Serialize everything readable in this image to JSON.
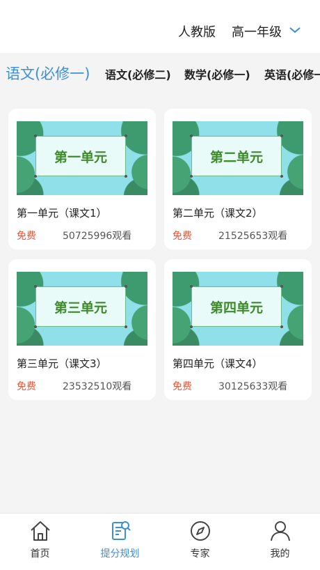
{
  "header": {
    "edition": "人教版",
    "grade": "高一年级",
    "grade_dropdown_icon": "chevron-down-icon"
  },
  "tabs": [
    {
      "label": "语文(必修一)",
      "active": true
    },
    {
      "label": "语文(必修二)",
      "active": false
    },
    {
      "label": "数学(必修一)",
      "active": false
    },
    {
      "label": "英语(必修一",
      "active": false
    }
  ],
  "cards": [
    {
      "thumb_text": "第一单元",
      "title": "第一单元（课文1）",
      "price": "免费",
      "views": "50725996观看"
    },
    {
      "thumb_text": "第二单元",
      "title": "第二单元（课文2）",
      "price": "免费",
      "views": "21525653观看"
    },
    {
      "thumb_text": "第三单元",
      "title": "第三单元（课文3）",
      "price": "免费",
      "views": "23532510观看"
    },
    {
      "thumb_text": "第四单元",
      "title": "第四单元（课文4）",
      "price": "免费",
      "views": "30125633观看"
    }
  ],
  "bottom_nav": [
    {
      "label": "首页",
      "icon": "home-icon",
      "active": false
    },
    {
      "label": "提分规划",
      "icon": "study-plan-icon",
      "active": true
    },
    {
      "label": "专家",
      "icon": "compass-icon",
      "active": false
    },
    {
      "label": "我的",
      "icon": "user-icon",
      "active": false
    }
  ],
  "colors": {
    "accent": "#3b8fd9",
    "free": "#e2573b",
    "background": "#f4f4f4"
  }
}
